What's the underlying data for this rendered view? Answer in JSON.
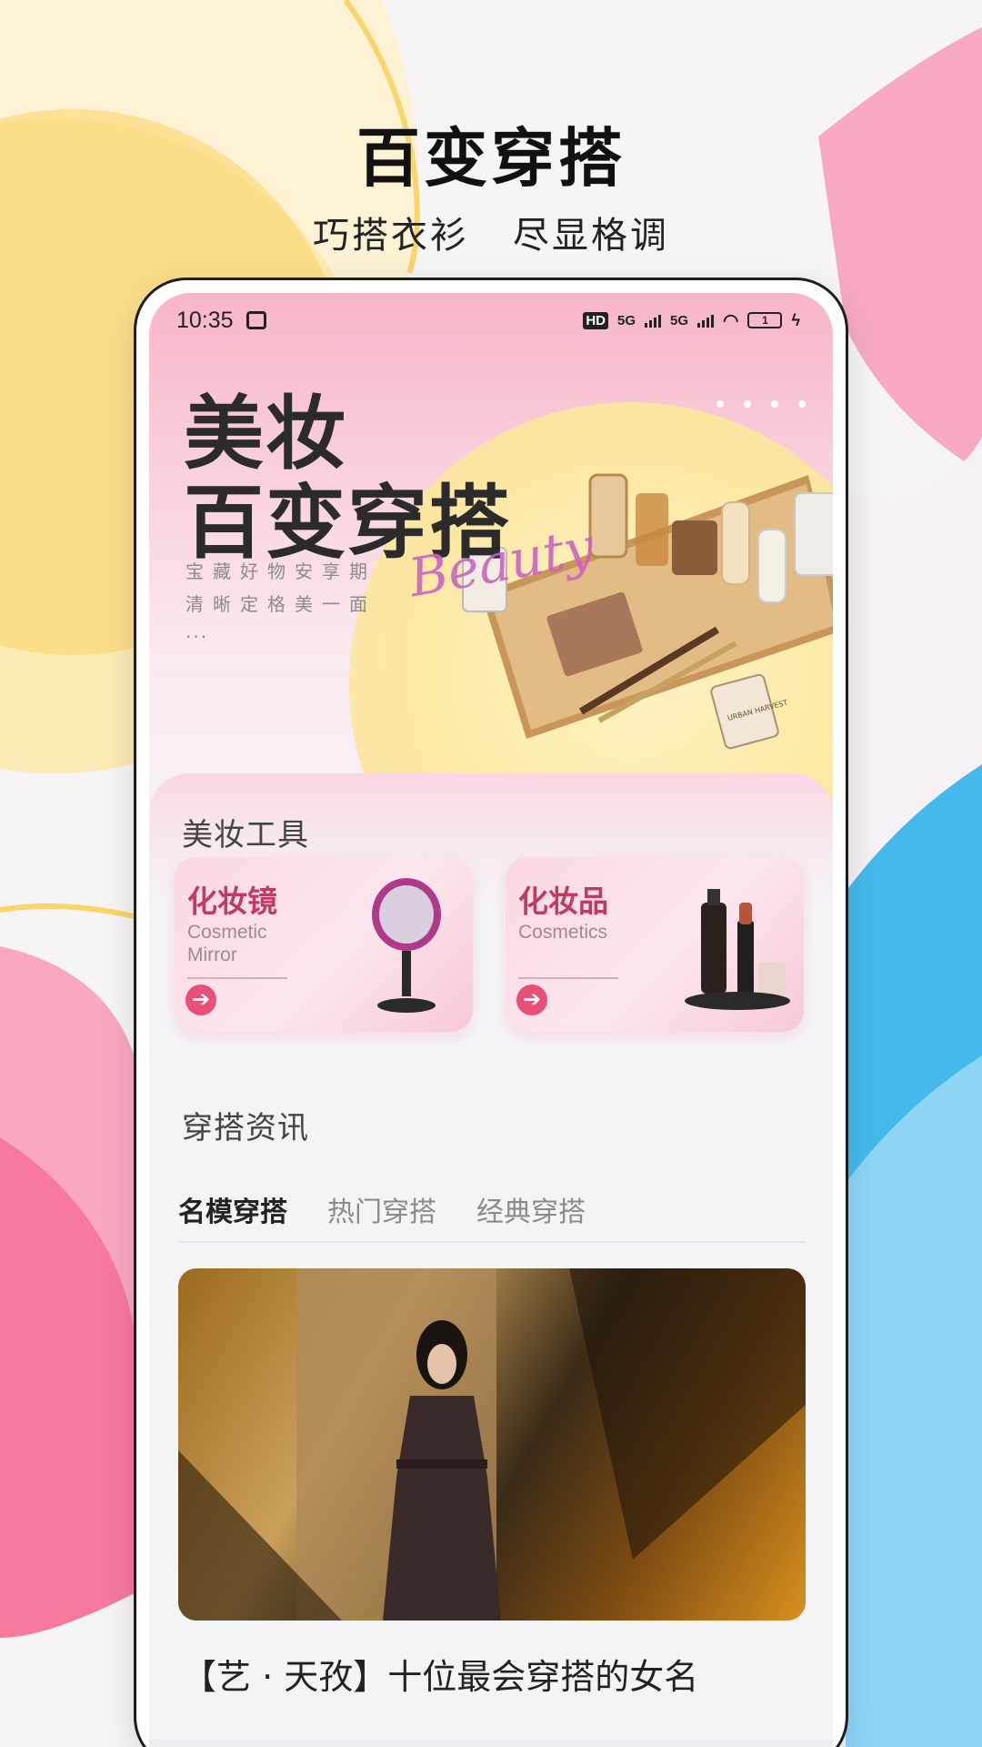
{
  "promo": {
    "title": "百变穿搭",
    "subtitle_left": "巧搭衣衫",
    "subtitle_right": "尽显格调"
  },
  "status_bar": {
    "time": "10:35",
    "hd": "HD",
    "net1": "5G",
    "net2": "5G",
    "battery": "1"
  },
  "hero": {
    "title_line1": "美妆",
    "title_line2": "百变穿搭",
    "script": "Beauty",
    "tagline1": "宝藏好物安享期",
    "tagline2": "清晰定格美一面",
    "tagline3": "...",
    "tag_label": "URBAN HARVEST"
  },
  "tools": {
    "section_title": "美妆工具",
    "items": [
      {
        "name": "化妆镜",
        "en": "Cosmetic Mirror",
        "icon": "mirror-icon"
      },
      {
        "name": "化妆品",
        "en": "Cosmetics",
        "icon": "cosmetics-icon"
      }
    ],
    "go_glyph": "➔"
  },
  "news": {
    "section_title": "穿搭资讯",
    "tabs": [
      "名模穿搭",
      "热门穿搭",
      "经典穿搭"
    ],
    "active_tab": 0,
    "article_title": "【艺 · 天孜】十位最会穿搭的女名"
  },
  "colors": {
    "accent": "#e8507a",
    "brand_text": "#c23a62"
  }
}
